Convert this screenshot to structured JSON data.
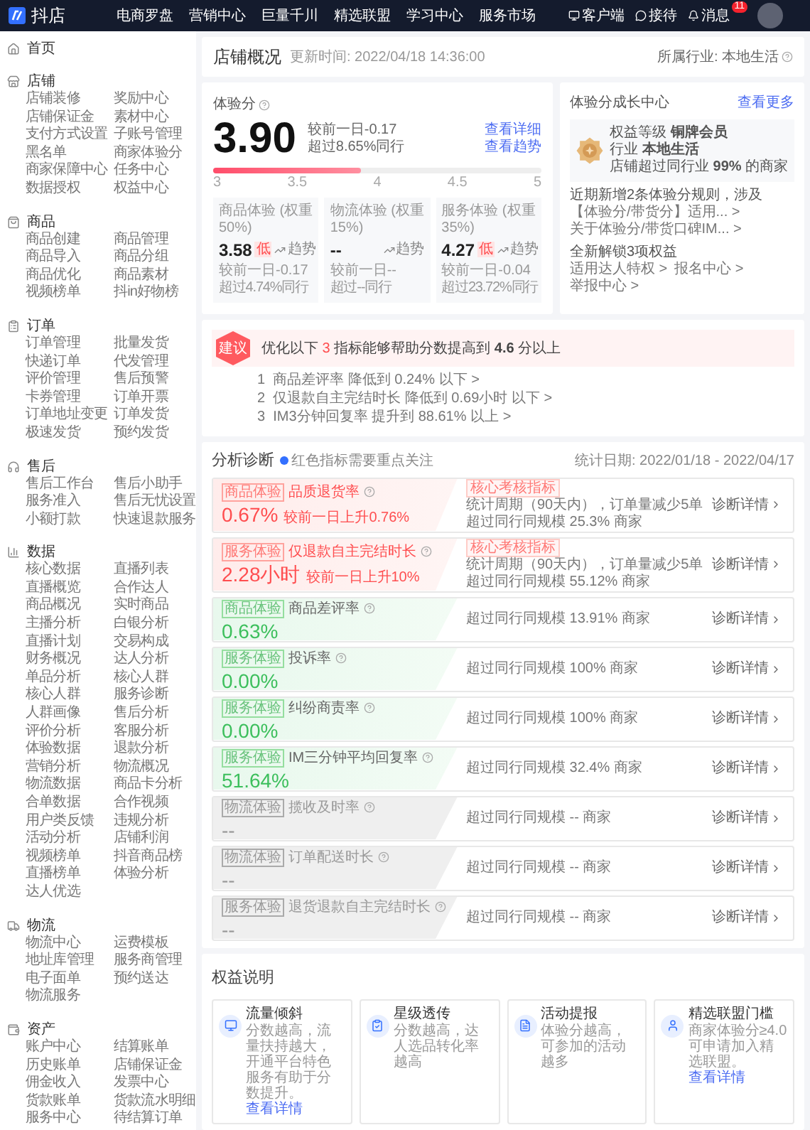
{
  "header": {
    "logo": "抖店",
    "nav": [
      "电商罗盘",
      "营销中心",
      "巨量千川",
      "精选联盟",
      "学习中心",
      "服务市场"
    ],
    "actions": [
      "客户端",
      "接待",
      "消息"
    ],
    "badge": "11"
  },
  "sidebar": {
    "home": "首页",
    "sections": [
      {
        "title": "店铺",
        "items": [
          "店铺装修",
          "奖励中心",
          "店铺保证金",
          "素材中心",
          "支付方式设置",
          "子账号管理",
          "黑名单",
          "商家体验分",
          "商家保障中心",
          "任务中心",
          "数据授权",
          "权益中心"
        ]
      },
      {
        "title": "商品",
        "items": [
          "商品创建",
          "商品管理",
          "商品导入",
          "商品分组",
          "商品优化",
          "商品素材",
          "视频榜单",
          "抖in好物榜"
        ]
      },
      {
        "title": "订单",
        "items": [
          "订单管理",
          "批量发货",
          "快递订单",
          "代发管理",
          "评价管理",
          "售后预警",
          "卡券管理",
          "订单开票",
          "订单地址变更",
          "订单发货",
          "极速发货",
          "预约发货"
        ]
      },
      {
        "title": "售后",
        "items": [
          "售后工作台",
          "售后小助手",
          "服务准入",
          "售后无忧设置",
          "小额打款",
          "快速退款服务"
        ]
      },
      {
        "title": "数据",
        "items": [
          "核心数据",
          "直播列表",
          "直播概览",
          "合作达人",
          "商品概况",
          "实时商品",
          "主播分析",
          "白银分析",
          "直播计划",
          "交易构成",
          "财务概况",
          "达人分析",
          "单品分析",
          "核心人群",
          "核心人群",
          "服务诊断",
          "人群画像",
          "售后分析",
          "评价分析",
          "客服分析",
          "体验数据",
          "退款分析",
          "营销分析",
          "物流概况",
          "物流数据",
          "商品卡分析",
          "合单数据",
          "合作视频",
          "用户类反馈",
          "违规分析",
          "活动分析",
          "店铺利润",
          "视频榜单",
          "抖音商品榜",
          "直播榜单",
          "体验分析",
          "达人优选"
        ]
      },
      {
        "title": "物流",
        "items": [
          "物流中心",
          "运费模板",
          "地址库管理",
          "服务商管理",
          "电子面单",
          "预约送达",
          "物流服务"
        ]
      },
      {
        "title": "资产",
        "items": [
          "账户中心",
          "结算账单",
          "历史账单",
          "店铺保证金",
          "佣金收入",
          "发票中心",
          "货款账单",
          "货款流水明细",
          "服务中心",
          "待结算订单"
        ]
      }
    ]
  },
  "overview": {
    "title": "店铺概况",
    "update_time": "更新时间: 2022/04/18 14:36:00",
    "industry": "所属行业: 本地生活"
  },
  "score": {
    "title": "体验分",
    "value": "3.90",
    "change": "较前一日-0.17",
    "rank": "超过8.65%同行",
    "links": [
      "查看详细",
      "查看趋势"
    ],
    "level": 0.45,
    "ticks": [
      "3",
      "3.5",
      "4",
      "4.5",
      "5"
    ],
    "parts": [
      {
        "title": "商品体验 (权重50%)",
        "trend": "趋势",
        "value": "3.58",
        "badge": "低",
        "change": "较前一日-0.17",
        "rank": "超过4.74%同行"
      },
      {
        "title": "物流体验 (权重15%)",
        "trend": "趋势",
        "value": "--",
        "change": "较前一日--",
        "rank": "超过--同行"
      },
      {
        "title": "服务体验 (权重35%)",
        "trend": "趋势",
        "value": "4.27",
        "badge": "低",
        "change": "较前一日-0.04",
        "rank": "超过23.72%同行"
      }
    ]
  },
  "growth": {
    "title": "体验分成长中心",
    "more": "查看更多",
    "lines": [
      "权益等级 **铜牌会员**",
      "行业 **本地生活**",
      "店铺超过同行业 **99%** 的商家"
    ],
    "rules_title": "近期新增2条体验分规则，涉及",
    "rules": [
      "【体验分/带货分】适用... >",
      "关于体验分/带货口碑IM... >"
    ],
    "rights_title": "全新解锁3项权益",
    "rights": [
      "适用达人特权 >",
      "报名中心 >",
      "举报中心 >"
    ]
  },
  "suggestion": {
    "badge": "建议",
    "lead": "优化以下",
    "count": "3",
    "rest": "指标能够帮助分数提高到 **4.6** 分以上",
    "items": [
      "1  商品差评率 降低到 0.24% 以下 >",
      "2  仅退款自主完结时长 降低到 0.69小时 以下 >",
      "3  IM3分钟回复率 提升到 88.61% 以上 >"
    ]
  },
  "analysis": {
    "title": "分析诊断",
    "hint": "红色指标需要重点关注",
    "period": "统计日期: 2022/01/18 - 2022/04/17",
    "rows": [
      {
        "kind": "bad",
        "tag": "商品体验",
        "name": "品质退货率",
        "value": "0.67%",
        "change": "较前一日上升0.76%",
        "core_tag": "核心考核指标",
        "stat": "统计周期（90天内），订单量减少5单",
        "beat": "超过同行同规模 25.3% 商家",
        "action": "诊断详情"
      },
      {
        "kind": "bad",
        "tag": "服务体验",
        "name": "仅退款自主完结时长",
        "value": "2.28小时",
        "change": "较前一日上升10%",
        "core_tag": "核心考核指标",
        "stat": "统计周期（90天内），订单量减少5单",
        "beat": "超过同行同规模 55.12% 商家",
        "action": "诊断详情"
      },
      {
        "kind": "good",
        "tag": "商品体验",
        "name": "商品差评率",
        "value": "0.63%",
        "beat": "超过同行同规模 13.91% 商家",
        "action": "诊断详情"
      },
      {
        "kind": "good",
        "tag": "服务体验",
        "name": "投诉率",
        "value": "0.00%",
        "beat": "超过同行同规模 100% 商家",
        "action": "诊断详情"
      },
      {
        "kind": "good",
        "tag": "服务体验",
        "name": "纠纷商责率",
        "value": "0.00%",
        "beat": "超过同行同规模 100% 商家",
        "action": "诊断详情"
      },
      {
        "kind": "good",
        "tag": "服务体验",
        "name": "IM三分钟平均回复率",
        "value": "51.64%",
        "beat": "超过同行同规模 32.4% 商家",
        "action": "诊断详情"
      },
      {
        "kind": "none",
        "tag": "物流体验",
        "name": "揽收及时率",
        "value": "--",
        "beat": "超过同行同规模 -- 商家",
        "action": "诊断详情"
      },
      {
        "kind": "none",
        "tag": "物流体验",
        "name": "订单配送时长",
        "value": "--",
        "beat": "超过同行同规模 -- 商家",
        "action": "诊断详情"
      },
      {
        "kind": "none",
        "tag": "服务体验",
        "name": "退货退款自主完结时长",
        "value": "--",
        "beat": "超过同行同规模 -- 商家",
        "action": "诊断详情"
      }
    ]
  },
  "rights": {
    "title": "权益说明",
    "cards": [
      {
        "title": "流量倾斜",
        "desc": "分数越高，流量扶持越大，开通平台特色服务有助于分数提升。",
        "link": "查看详情"
      },
      {
        "title": "星级透传",
        "desc": "分数越高，达人选品转化率越高"
      },
      {
        "title": "活动提报",
        "desc": "体验分越高，可参加的活动越多"
      },
      {
        "title": "精选联盟门槛",
        "desc": "商家体验分≥4.0可申请加入精选联盟。",
        "link": "查看详情"
      }
    ]
  }
}
